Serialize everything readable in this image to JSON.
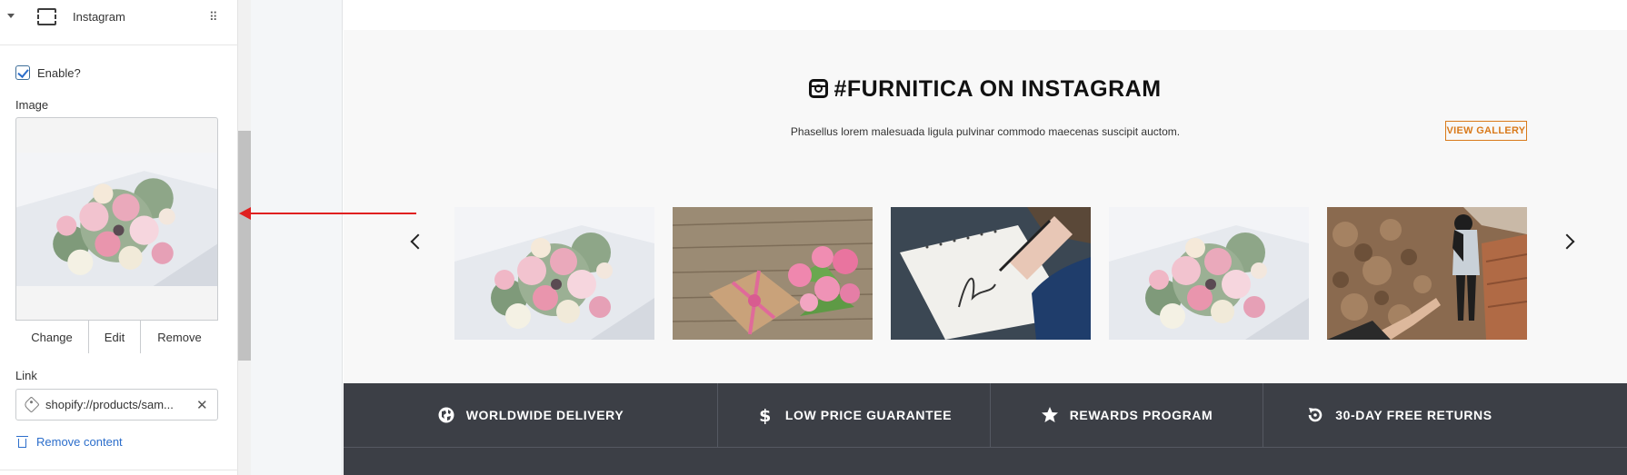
{
  "panel": {
    "section_title": "Instagram",
    "enable_label": "Enable?",
    "enabled": true,
    "image_label": "Image",
    "image_actions": [
      "Change",
      "Edit",
      "Remove"
    ],
    "link_label": "Link",
    "link_value": "shopify://products/sam...",
    "remove_content_label": "Remove content"
  },
  "preview": {
    "title": "#FURNITICA ON INSTAGRAM",
    "subtitle": "Phasellus lorem malesuada ligula pulvinar commodo maecenas suscipit auctom.",
    "view_gallery_label": "VIEW GALLERY",
    "thumbnails": [
      "bouquet-photo",
      "roses-gift-photo",
      "notebook-writing-photo",
      "bouquet-photo",
      "couple-wall-photo"
    ],
    "features": [
      {
        "label": "WORLDWIDE DELIVERY",
        "icon": "globe-icon"
      },
      {
        "label": "LOW PRICE GUARANTEE",
        "icon": "dollar-icon"
      },
      {
        "label": "REWARDS PROGRAM",
        "icon": "star-icon"
      },
      {
        "label": "30-DAY FREE RETURNS",
        "icon": "return-icon"
      }
    ]
  },
  "colors": {
    "accent_link": "#2c6ecb",
    "view_gallery": "#d97a1b",
    "footer_bar": "#3c3f46",
    "annotation_arrow": "#e02020"
  }
}
